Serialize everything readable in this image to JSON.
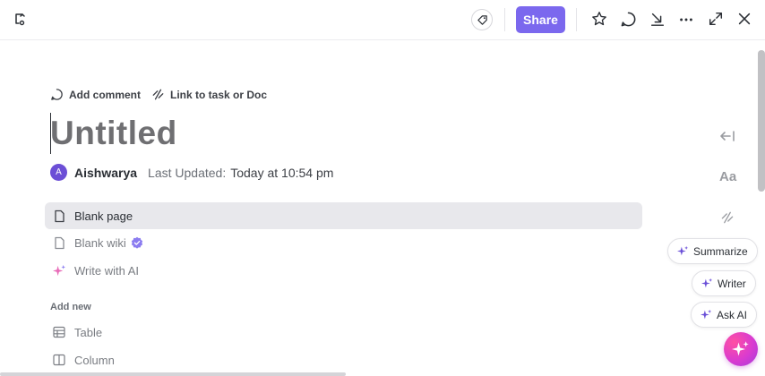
{
  "topbar": {
    "share_label": "Share"
  },
  "doc": {
    "add_comment": "Add comment",
    "link_task": "Link to task or Doc",
    "title_placeholder": "Untitled",
    "author_initial": "A",
    "author": "Aishwarya",
    "last_updated_label": "Last Updated:",
    "last_updated_value": "Today at 10:54 pm"
  },
  "options": [
    {
      "label": "Blank page",
      "icon": "page-icon"
    },
    {
      "label": "Blank wiki",
      "icon": "page-icon"
    },
    {
      "label": "Write with AI",
      "icon": "sparkle-icon"
    }
  ],
  "add_new": {
    "heading": "Add new",
    "items": [
      {
        "label": "Table",
        "icon": "table-icon"
      },
      {
        "label": "Column",
        "icon": "column-icon"
      }
    ]
  },
  "sidebar": {
    "font_label": "Aa"
  },
  "ai": {
    "summarize": "Summarize",
    "writer": "Writer",
    "ask_ai": "Ask AI"
  },
  "colors": {
    "accent": "#7b68ee",
    "ai_fab": "#e040b8"
  }
}
